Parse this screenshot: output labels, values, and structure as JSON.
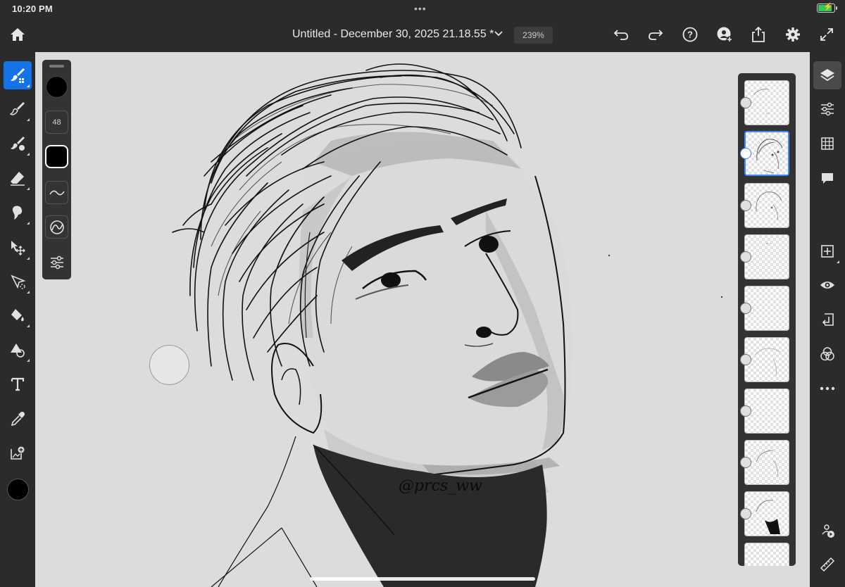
{
  "status_bar": {
    "time": "10:20 PM",
    "battery_level": 0.85,
    "battery_charging": true,
    "multitask_icon": "ellipsis-icon"
  },
  "top_bar": {
    "document_title": "Untitled - December 30, 2025 21.18.55 *",
    "zoom_level": "239%",
    "icons": [
      "home-icon",
      "chevron-down-icon",
      "undo-icon",
      "redo-icon",
      "help-icon",
      "invite-icon",
      "share-icon",
      "settings-gear-icon",
      "fullscreen-icon"
    ]
  },
  "left_toolbar": {
    "active_tool": "brush",
    "tools": [
      "brush-tool",
      "paint-brush-tool",
      "smudge-tool",
      "eraser-tool",
      "lasso-tool",
      "move-transform-tool",
      "selection-tool",
      "fill-tool",
      "shape-tool",
      "type-tool",
      "eyedropper-tool",
      "place-image-tool"
    ],
    "current_color": "#000000"
  },
  "brush_panel": {
    "brush_color": "#000000",
    "size": "48",
    "icons": [
      "square-brush-tip-icon",
      "smoothing-curve-icon",
      "pressure-icon",
      "brush-settings-sliders-icon"
    ]
  },
  "canvas": {
    "watermark_text": "@prcs_ww",
    "background_color": "#dcdcdc"
  },
  "layers_panel": {
    "layer_count_visible": 10,
    "selected_layer_index": 1,
    "layers": [
      {
        "name": "layer-1",
        "content": "sketch"
      },
      {
        "name": "layer-2",
        "content": "portrait-lineart"
      },
      {
        "name": "layer-3",
        "content": "portrait-sketch"
      },
      {
        "name": "layer-4",
        "content": "marks"
      },
      {
        "name": "layer-5",
        "content": "empty"
      },
      {
        "name": "layer-6",
        "content": "face-outline"
      },
      {
        "name": "layer-7",
        "content": "empty"
      },
      {
        "name": "layer-8",
        "content": "face-sketch"
      },
      {
        "name": "layer-9",
        "content": "turtleneck"
      },
      {
        "name": "layer-10",
        "content": "empty"
      }
    ]
  },
  "right_toolbar": {
    "icons": [
      "layers-icon",
      "adjustments-icon",
      "grid-icon",
      "comments-icon",
      "add-layer-icon",
      "visibility-eye-icon",
      "import-icon",
      "blend-mode-icon",
      "more-icon",
      "remove-background-icon",
      "ruler-icon"
    ]
  },
  "accent_color": "#1473e6"
}
